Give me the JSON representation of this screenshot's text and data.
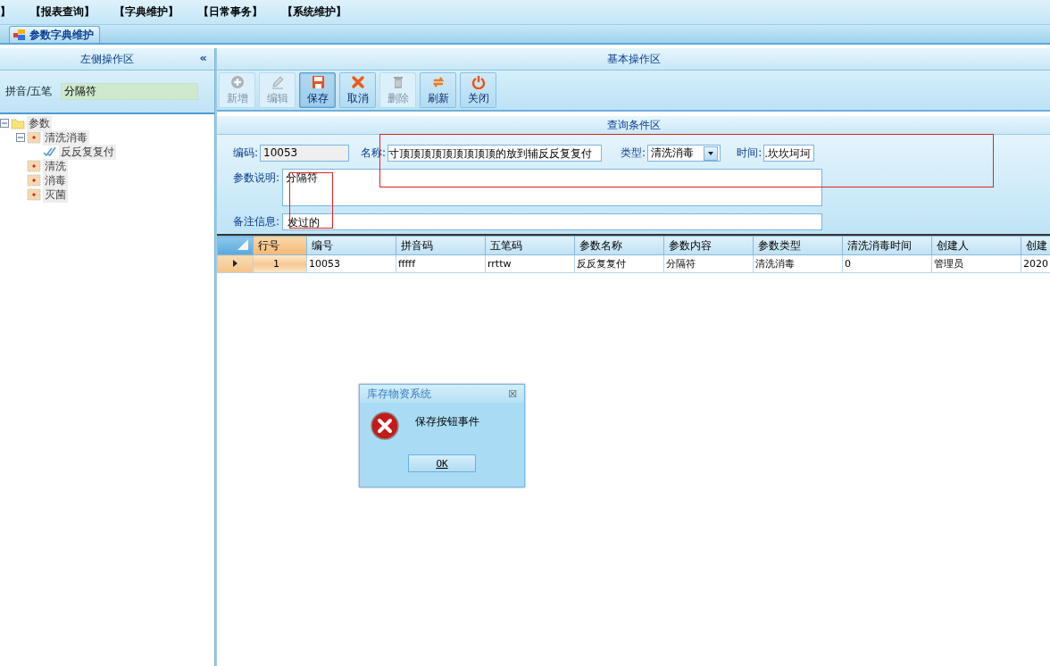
{
  "menu": [
    "】",
    "【报表查询】",
    "【字典维护】",
    "【日常事务】",
    "【系统维护】"
  ],
  "tabs": [
    {
      "label": "参数字典维护",
      "selected": true
    }
  ],
  "left_panel": {
    "title": "左侧操作区",
    "collapse": "«",
    "filter_label": "拼音/五笔",
    "filter_value": "分隔符",
    "tree": [
      {
        "label": "参数",
        "kind": "folder",
        "expanded": true,
        "children": [
          {
            "label": "清洗消毒",
            "kind": "category",
            "expanded": true,
            "children": [
              {
                "label": "反反复复付",
                "kind": "item"
              }
            ]
          },
          {
            "label": "清洗",
            "kind": "category"
          },
          {
            "label": "消毒",
            "kind": "category"
          },
          {
            "label": "灭菌",
            "kind": "category"
          }
        ]
      }
    ]
  },
  "toolbar": {
    "title": "基本操作区",
    "buttons": [
      {
        "label": "新增",
        "kind": "add",
        "disabled": true,
        "pressed": false
      },
      {
        "label": "编辑",
        "kind": "edit",
        "disabled": true,
        "pressed": false
      },
      {
        "label": "保存",
        "kind": "save",
        "disabled": false,
        "pressed": true
      },
      {
        "label": "取消",
        "kind": "cancel",
        "disabled": false,
        "pressed": false
      },
      {
        "label": "删除",
        "kind": "delete",
        "disabled": true,
        "pressed": false
      },
      {
        "label": "刷新",
        "kind": "refresh",
        "disabled": false,
        "pressed": false
      },
      {
        "label": "关闭",
        "kind": "close",
        "disabled": false,
        "pressed": false
      }
    ]
  },
  "query": {
    "title": "查询条件区",
    "code": {
      "label": "编码:",
      "value": "10053"
    },
    "name": {
      "label": "名称:",
      "value": "寸顶顶顶顶顶顶顶顶顶的放到辅反反复复付"
    },
    "type": {
      "label": "类型:",
      "value": "清洗消毒"
    },
    "time": {
      "label": "时间:",
      "value": ".坎坎坷坷"
    },
    "description": {
      "label": "参数说明:",
      "value": "分隔符"
    },
    "remark": {
      "label": "备注信息:",
      "value": "发过的"
    }
  },
  "table": {
    "columns": [
      "行号",
      "编号",
      "拼音码",
      "五笔码",
      "参数名称",
      "参数内容",
      "参数类型",
      "清洗消毒时间",
      "创建人",
      "创建"
    ],
    "rows": [
      {
        "selected": true,
        "cells": [
          "1",
          "10053",
          "fffff",
          "rrttw",
          "反反复复付",
          "分隔符",
          "清洗消毒",
          "0",
          "管理员",
          "2020"
        ]
      }
    ]
  },
  "dialog": {
    "title": "库存物资系统",
    "close": "☒",
    "message": "保存按钮事件",
    "button": "OK"
  }
}
